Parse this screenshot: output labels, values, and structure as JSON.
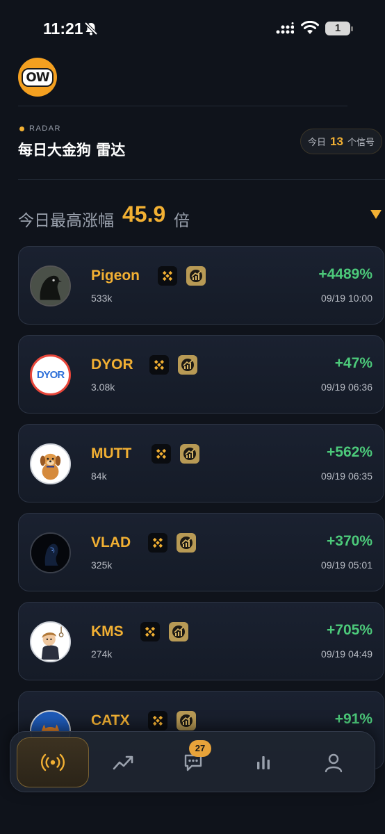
{
  "status_bar": {
    "time": "11:21",
    "battery": "1"
  },
  "header": {
    "logo_text": "OW",
    "radar_tag": "RADAR",
    "title": "每日大金狗 雷达",
    "signals_prefix": "今日",
    "signals_count": "13",
    "signals_suffix": "个信号"
  },
  "summary": {
    "label": "今日最高涨幅",
    "value": "45.9",
    "unit": "倍"
  },
  "tokens": [
    {
      "name": "Pigeon",
      "volume": "533k",
      "change": "+4489%",
      "time": "09/19 10:00",
      "avatar_icon": "pigeon-avatar-icon"
    },
    {
      "name": "DYOR",
      "volume": "3.08k",
      "change": "+47%",
      "time": "09/19 06:36",
      "avatar_icon": "dyor-avatar-icon",
      "avatar_text": "DYOR"
    },
    {
      "name": "MUTT",
      "volume": "84k",
      "change": "+562%",
      "time": "09/19 06:35",
      "avatar_icon": "dog-avatar-icon"
    },
    {
      "name": "VLAD",
      "volume": "325k",
      "change": "+370%",
      "time": "09/19 05:01",
      "avatar_icon": "dark-figure-avatar-icon"
    },
    {
      "name": "KMS",
      "volume": "274k",
      "change": "+705%",
      "time": "09/19 04:49",
      "avatar_icon": "character-avatar-icon"
    },
    {
      "name": "CATX",
      "volume": "",
      "change": "+91%",
      "time": "",
      "avatar_icon": "cat-avatar-icon"
    }
  ],
  "tabbar": {
    "items": [
      {
        "icon": "radar-icon",
        "active": true
      },
      {
        "icon": "trend-icon",
        "active": false
      },
      {
        "icon": "chat-icon",
        "active": false,
        "badge": "27"
      },
      {
        "icon": "bar-chart-icon",
        "active": false
      },
      {
        "icon": "profile-icon",
        "active": false
      }
    ]
  },
  "colors": {
    "accent": "#f2b033",
    "positive": "#4cc97a",
    "background": "#0f131b",
    "card": "#1a2130"
  }
}
